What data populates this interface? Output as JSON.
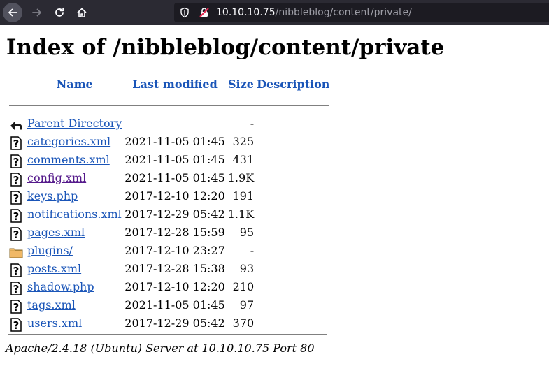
{
  "browser": {
    "url_host": "10.10.10.75",
    "url_path": "/nibbleblog/content/private/",
    "colors": {
      "toolbar": "#2b2a33",
      "urlbar": "#1c1b22",
      "lock_slash": "#e22850"
    }
  },
  "page": {
    "title": "Index of /nibbleblog/content/private",
    "headers": {
      "name": "Name",
      "modified": "Last modified",
      "size": "Size",
      "description": "Description"
    },
    "parent": {
      "label": "Parent Directory",
      "size": "-"
    },
    "rows": [
      {
        "name": "categories.xml",
        "modified": "2021-11-05 01:45",
        "size": "325",
        "icon": "unknown-file-icon"
      },
      {
        "name": "comments.xml",
        "modified": "2021-11-05 01:45",
        "size": "431",
        "icon": "unknown-file-icon"
      },
      {
        "name": "config.xml",
        "modified": "2021-11-05 01:45",
        "size": "1.9K",
        "icon": "unknown-file-icon",
        "visited": true
      },
      {
        "name": "keys.php",
        "modified": "2017-12-10 12:20",
        "size": "191",
        "icon": "unknown-file-icon"
      },
      {
        "name": "notifications.xml",
        "modified": "2017-12-29 05:42",
        "size": "1.1K",
        "icon": "unknown-file-icon"
      },
      {
        "name": "pages.xml",
        "modified": "2017-12-28 15:59",
        "size": "95",
        "icon": "unknown-file-icon"
      },
      {
        "name": "plugins/",
        "modified": "2017-12-10 23:27",
        "size": "-",
        "icon": "folder-icon"
      },
      {
        "name": "posts.xml",
        "modified": "2017-12-28 15:38",
        "size": "93",
        "icon": "unknown-file-icon"
      },
      {
        "name": "shadow.php",
        "modified": "2017-12-10 12:20",
        "size": "210",
        "icon": "unknown-file-icon"
      },
      {
        "name": "tags.xml",
        "modified": "2021-11-05 01:45",
        "size": "97",
        "icon": "unknown-file-icon"
      },
      {
        "name": "users.xml",
        "modified": "2017-12-29 05:42",
        "size": "370",
        "icon": "unknown-file-icon"
      }
    ],
    "footer": "Apache/2.4.18 (Ubuntu) Server at 10.10.10.75 Port 80"
  }
}
